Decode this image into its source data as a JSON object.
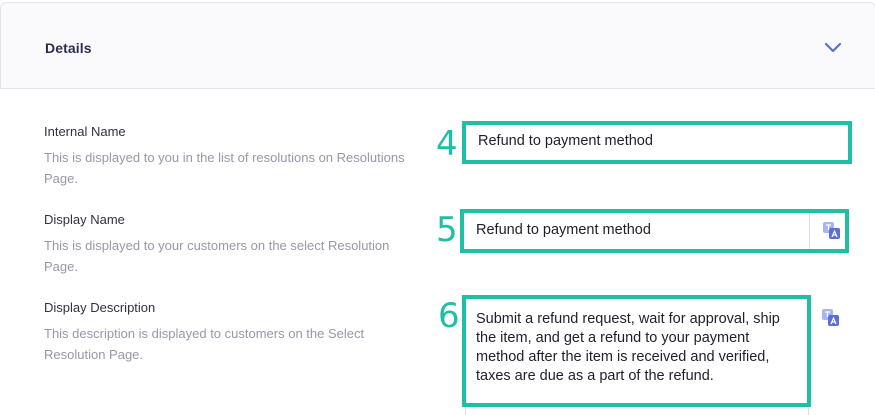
{
  "section": {
    "title": "Details",
    "toggle_icon": "chevron-down-icon"
  },
  "fields": {
    "internal_name": {
      "label": "Internal Name",
      "help": "This is displayed to you in the list of resolutions on Resolutions Page.",
      "step": "4",
      "value": "Refund to payment method"
    },
    "display_name": {
      "label": "Display Name",
      "help": "This is displayed to your customers on the select Resolution Page.",
      "step": "5",
      "value": "Refund to payment method",
      "translate_icon": "translate-icon"
    },
    "display_description": {
      "label": "Display Description",
      "help": "This description is displayed to customers on the Select Resolution Page.",
      "step": "6",
      "value": "Submit a refund request, wait for approval, ship the item, and get a refund to your payment method after the item is received and verified, taxes are due as a part of the refund.",
      "translate_icon": "translate-icon"
    }
  },
  "colors": {
    "highlight": "#1fbfa6",
    "accent_icon": "#5b6fd6",
    "muted_text": "#9798a8"
  }
}
